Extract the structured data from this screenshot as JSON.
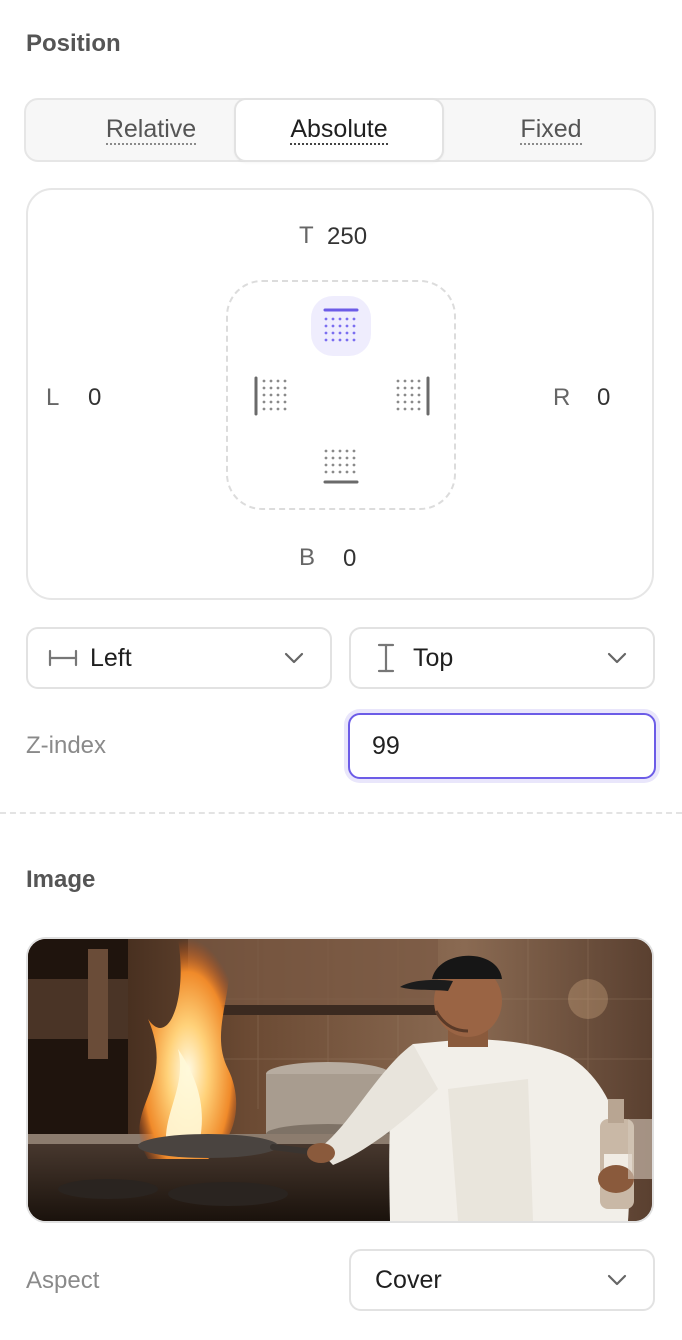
{
  "position": {
    "section_title": "Position",
    "modes": [
      "Relative",
      "Absolute",
      "Fixed"
    ],
    "active_mode": "Absolute",
    "offsets": {
      "top_label": "T",
      "top_value": "250",
      "left_label": "L",
      "left_value": "0",
      "right_label": "R",
      "right_value": "0",
      "bottom_label": "B",
      "bottom_value": "0"
    },
    "active_anchor": "top",
    "horizontal_anchor": {
      "label": "Left",
      "icon": "horizontal-span-icon"
    },
    "vertical_anchor": {
      "label": "Top",
      "icon": "vertical-span-icon"
    },
    "zindex": {
      "label": "Z-index",
      "value": "99"
    }
  },
  "image": {
    "section_title": "Image",
    "preview_alt": "chef-flambe-photo",
    "aspect_label": "Aspect",
    "aspect_value": "Cover"
  },
  "colors": {
    "accent": "#6c5ce7",
    "accent_bg": "#efedfd",
    "border": "#e2e2e2"
  }
}
